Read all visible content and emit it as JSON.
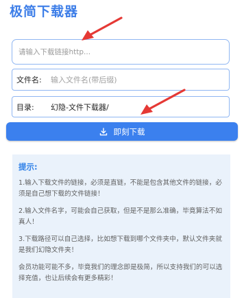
{
  "app": {
    "title": "极简下载器"
  },
  "url_field": {
    "placeholder": "请输入下载链接http..."
  },
  "filename_field": {
    "label": "文件名:",
    "placeholder": "输入文件名(带后缀)"
  },
  "directory_field": {
    "label": "目录:",
    "value": "幻隐-文件下载器/"
  },
  "download_button": {
    "label": "即刻下载",
    "icon": "download-icon"
  },
  "tips": {
    "title": "提示:",
    "items": [
      "1.输入下载文件的链接，必须是直链，不能是包含其他文件的链接，必须是自己想下载的文件链接！",
      "2.输入文件名字，可能会自己获取，但是不是那么准确，毕竟算法不如真人！",
      "3.下载路径可以自己选择，比如想下载到哪个文件夹中，默认文件夹就是我们幻隐文件夹！",
      "会员功能可能不多，毕竟我们的理念即是极简，所以支持我们的可以选择充值，也让后续会有更多精彩！"
    ]
  },
  "colors": {
    "accent": "#3b80ee",
    "title": "#3d7ee8",
    "field_border": "#8fb6f2",
    "tips_background": "#eaf2fb",
    "annotation_arrow": "#e53935"
  }
}
